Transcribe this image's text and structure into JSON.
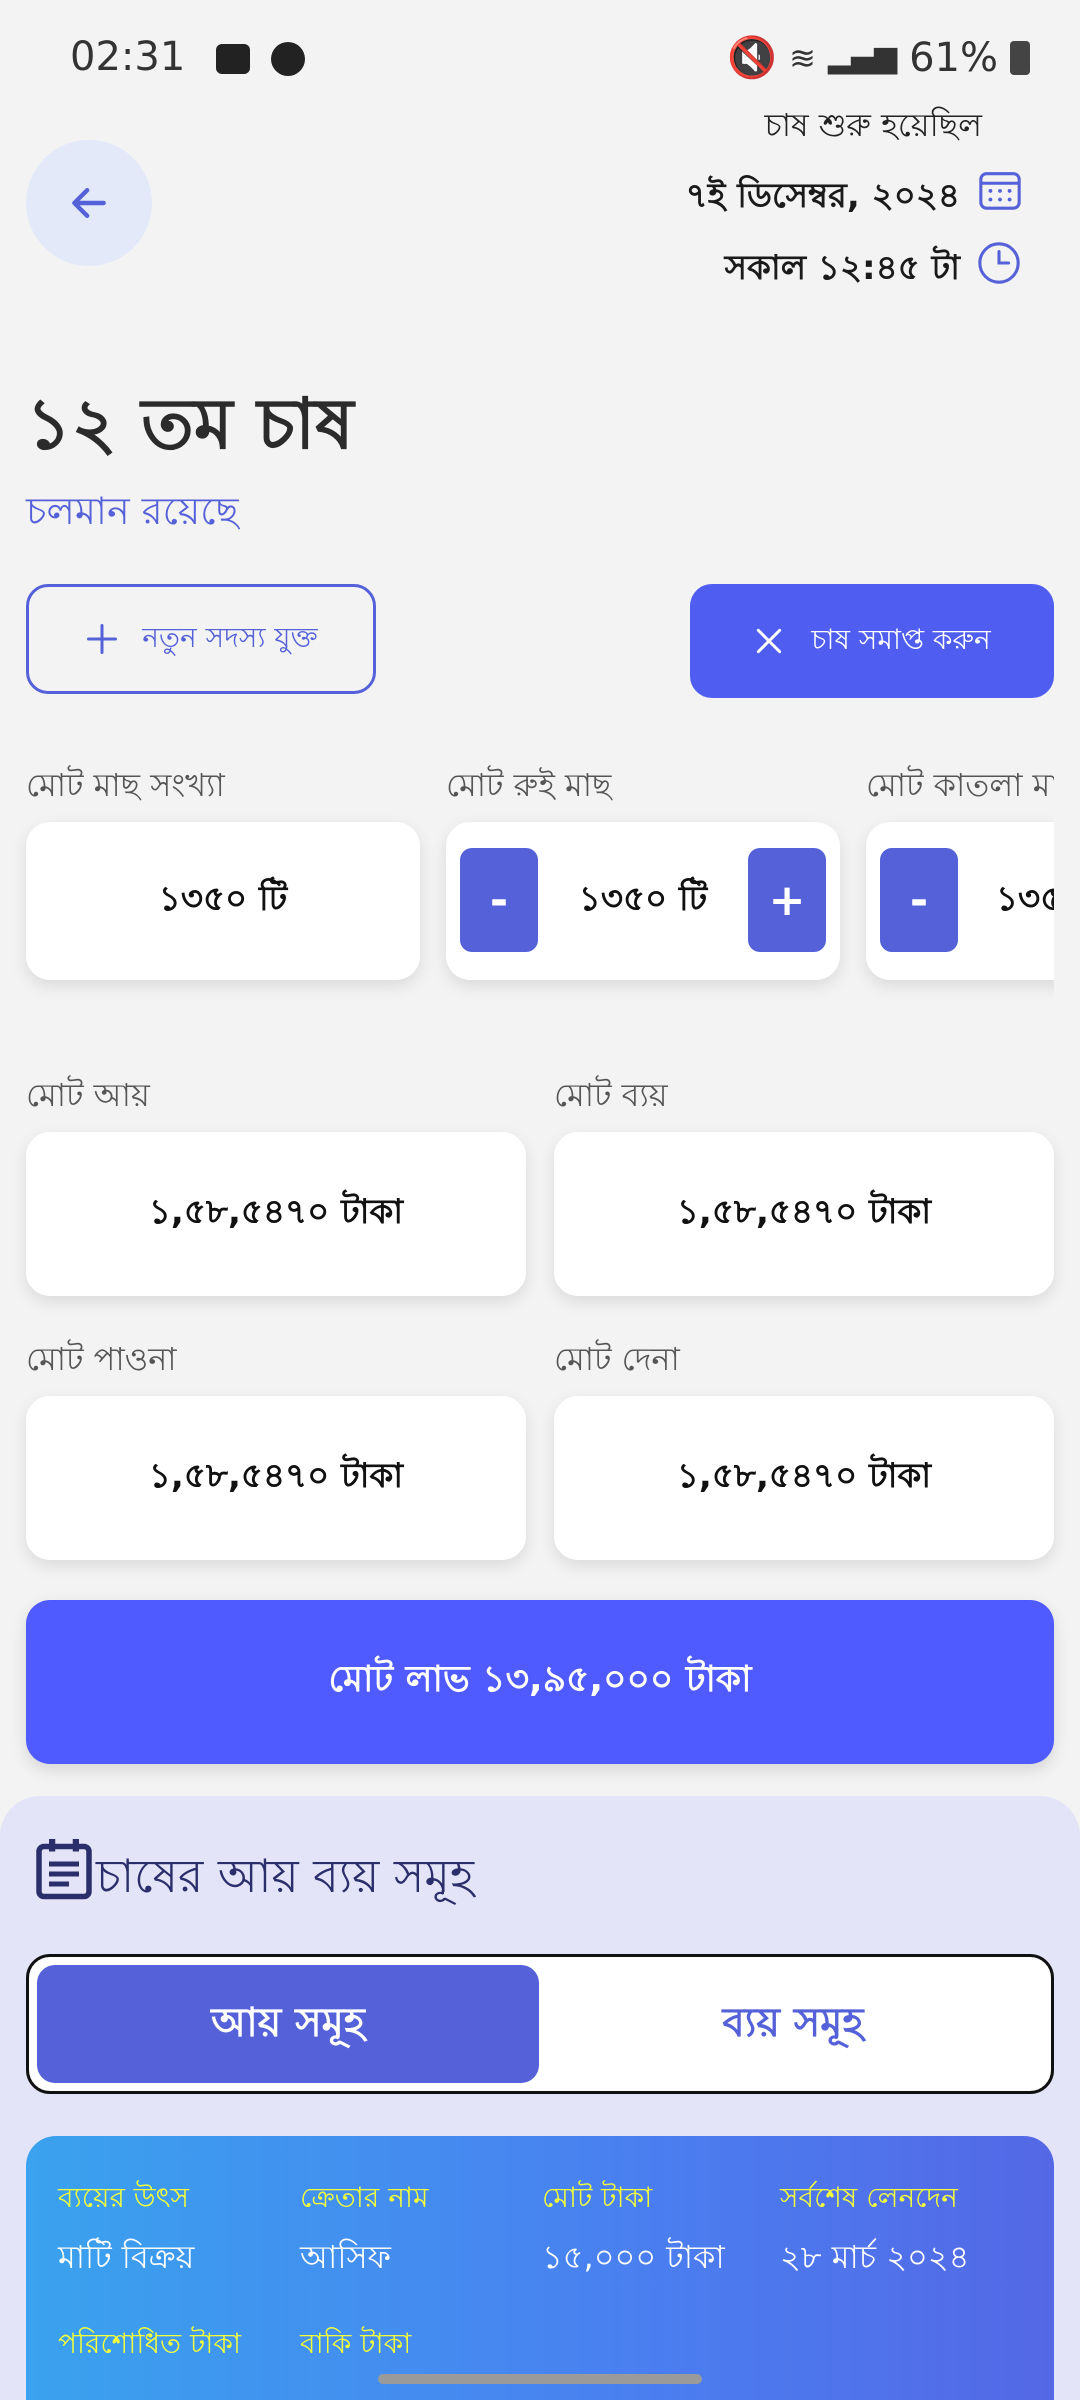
{
  "status_bar": {
    "time": "02:31",
    "battery": "61%"
  },
  "header": {
    "started_label": "চাষ শুরু হয়েছিল",
    "date": "৭ই ডিসেম্বর, ২০২৪",
    "time": "সকাল ১২:৪৫ টা"
  },
  "title": "১২ তম চাষ",
  "status": "চলমান রয়েছে",
  "actions": {
    "add_member": "নতুন সদস্য যুক্ত",
    "end_farming": "চাষ সমাপ্ত করুন"
  },
  "fish_stats": [
    {
      "label": "মোট মাছ সংখ্যা",
      "value": "১৩৫০ টি"
    },
    {
      "label": "মোট রুই মাছ",
      "value": "১৩৫০ টি",
      "minus": "-",
      "plus": "+"
    },
    {
      "label": "মোট কাতলা মা",
      "value": "১৩৫",
      "minus": "-"
    }
  ],
  "finance": {
    "income": {
      "label": "মোট আয়",
      "value": "১,৫৮,৫৪৭০ টাকা"
    },
    "expense": {
      "label": "মোট ব্যয়",
      "value": "১,৫৮,৫৪৭০ টাকা"
    },
    "receivable": {
      "label": "মোট পাওনা",
      "value": "১,৫৮,৫৪৭০ টাকা"
    },
    "payable": {
      "label": "মোট দেনা",
      "value": "১,৫৮,৫৪৭০ টাকা"
    }
  },
  "profit": "মোট লাভ ১৩,৯৫,০০০ টাকা",
  "section": {
    "title": "চাষের আয় ব্যয় সমূহ",
    "tabs": [
      "আয় সমূহ",
      "ব্যয় সমূহ"
    ]
  },
  "record": {
    "source_label": "ব্যয়ের উৎস",
    "source_value": "মাটি বিক্রয়",
    "buyer_label": "ক্রেতার নাম",
    "buyer_value": "আসিফ",
    "total_label": "মোট টাকা",
    "total_value": "১৫,০০০ টাকা",
    "last_tx_label": "সর্বশেষ লেনদেন",
    "last_tx_value": "২৮ মার্চ ২০২৪",
    "paid_label": "পরিশোধিত টাকা",
    "due_label": "বাকি টাকা"
  }
}
